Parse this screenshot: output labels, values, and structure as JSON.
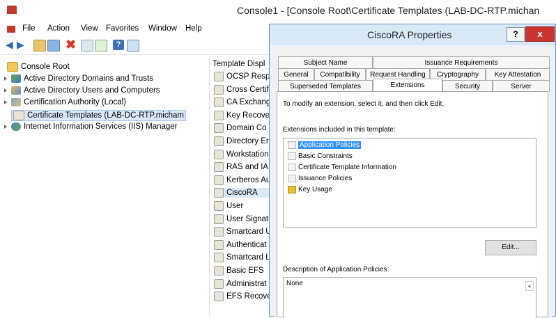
{
  "window": {
    "title": "Console1 - [Console Root\\Certificate Templates (LAB-DC-RTP.michan"
  },
  "menu": [
    "File",
    "Action",
    "View",
    "Favorites",
    "Window",
    "Help"
  ],
  "tree": {
    "root": "Console Root",
    "items": [
      {
        "label": "Active Directory Domains and Trusts",
        "icon": "ad-domains-icon"
      },
      {
        "label": "Active Directory Users and Computers",
        "icon": "ad-users-icon"
      },
      {
        "label": "Certification Authority (Local)",
        "icon": "ca-icon"
      },
      {
        "label": "Certificate Templates (LAB-DC-RTP.micham",
        "icon": "certificate-icon"
      },
      {
        "label": "Internet Information Services (IIS) Manager",
        "icon": "iis-icon"
      }
    ]
  },
  "list": {
    "header": "Template Displ",
    "items": [
      "OCSP Respo",
      "Cross Certif",
      "CA Exchang",
      "Key Recover",
      "Domain Co",
      "Directory Er",
      "Workstation",
      "RAS and IAS",
      "Kerberos Au",
      "CiscoRA",
      "User",
      "User Signatu",
      "Smartcard U",
      "Authenticat",
      "Smartcard L",
      "Basic EFS",
      "Administrat",
      "EFS Recover"
    ]
  },
  "dialog": {
    "title": "CiscoRA Properties",
    "help": "?",
    "close": "x",
    "tabs_row1": [
      "Subject Name",
      "Issuance Requirements"
    ],
    "tabs_row2": [
      "General",
      "Compatibility",
      "Request Handling",
      "Cryptography",
      "Key Attestation"
    ],
    "tabs_row3": [
      "Superseded Templates",
      "Extensions",
      "Security",
      "Server"
    ],
    "instruction": "To modify an extension, select it, and then click Edit.",
    "ext_label": "Extensions included in this template:",
    "extensions": [
      "Application Policies",
      "Basic Constraints",
      "Certificate Template Information",
      "Issuance Policies",
      "Key Usage"
    ],
    "edit_label": "Edit...",
    "desc_label": "Description of Application Policies:",
    "desc_value": "None"
  },
  "colors": {
    "selection": "#3390ff",
    "close": "#c9352c",
    "dialog_frame": "#d9e8f6"
  }
}
